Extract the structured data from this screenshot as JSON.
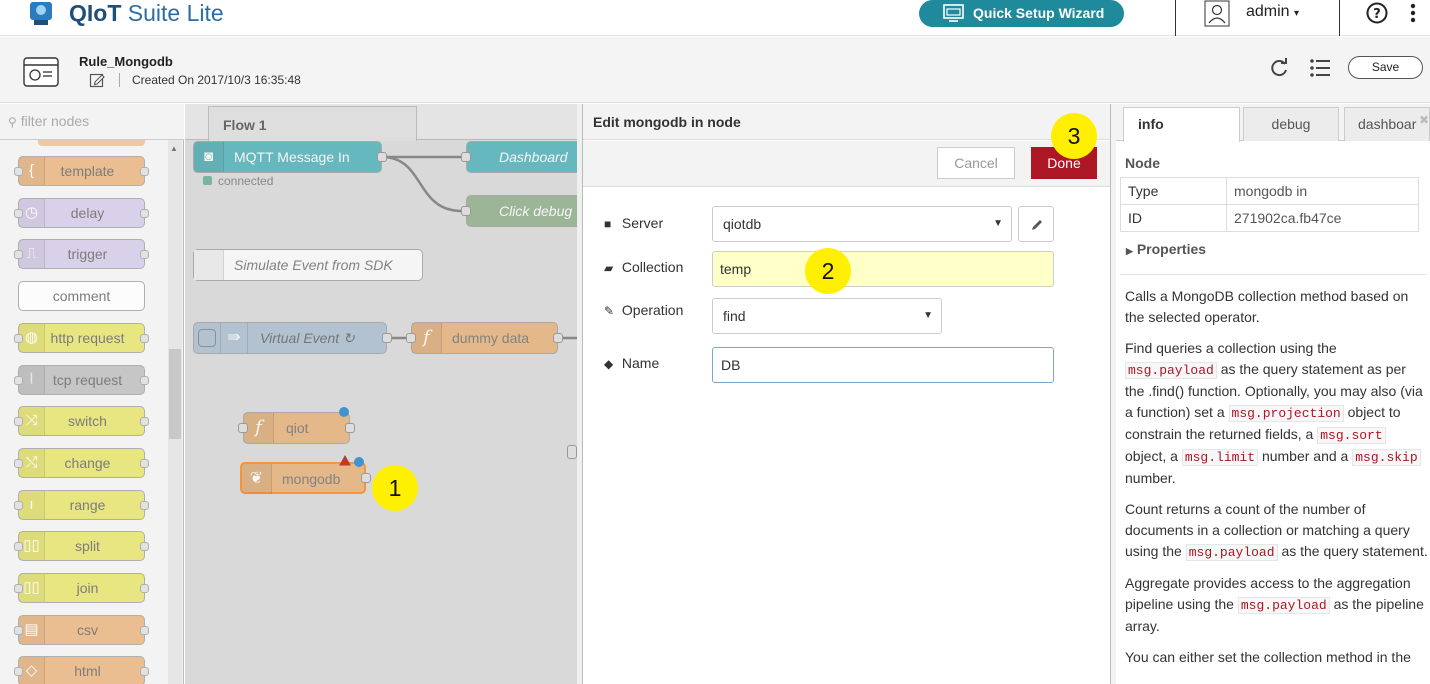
{
  "app": {
    "brand_bold": "QIoT",
    "brand_rest": "Suite Lite",
    "wizard_label": "Quick Setup Wizard",
    "user": "admin"
  },
  "rule": {
    "name": "Rule_Mongodb",
    "created": "Created On 2017/10/3 16:35:48",
    "save_label": "Save"
  },
  "palette": {
    "filter_placeholder": "filter nodes",
    "items": [
      {
        "label": "template",
        "color": "#e8ad6f"
      },
      {
        "label": "delay",
        "color": "#d0c6e6"
      },
      {
        "label": "trigger",
        "color": "#d0c6e6"
      },
      {
        "label": "comment",
        "color": "#ffffff"
      },
      {
        "label": "http request",
        "color": "#e5e25a"
      },
      {
        "label": "tcp request",
        "color": "#b8b8b8"
      },
      {
        "label": "switch",
        "color": "#e5e25a"
      },
      {
        "label": "change",
        "color": "#e5e25a"
      },
      {
        "label": "range",
        "color": "#e5e25a"
      },
      {
        "label": "split",
        "color": "#e5e25a"
      },
      {
        "label": "join",
        "color": "#e5e25a"
      },
      {
        "label": "csv",
        "color": "#e8ad6f"
      },
      {
        "label": "html",
        "color": "#e8ad6f"
      }
    ]
  },
  "flow": {
    "tab_label": "Flow 1",
    "nodes": {
      "mqtt": "MQTT Message In",
      "mqtt_status": "connected",
      "dashboard": "Dashboard",
      "click_debug": "Click debug",
      "simulate": "Simulate Event from SDK",
      "virtual": "Virtual Event ↻",
      "dummy": "dummy data",
      "qiot": "qiot",
      "mongodb": "mongodb"
    }
  },
  "editor": {
    "title": "Edit mongodb in node",
    "cancel_label": "Cancel",
    "done_label": "Done",
    "fields": {
      "server_label": "Server",
      "server_value": "qiotdb",
      "collection_label": "Collection",
      "collection_value": "temp",
      "operation_label": "Operation",
      "operation_value": "find",
      "name_label": "Name",
      "name_value": "DB"
    }
  },
  "badges": {
    "one": "1",
    "two": "2",
    "three": "3"
  },
  "sidebar": {
    "tabs": [
      "info",
      "debug",
      "dashboar"
    ],
    "node_heading": "Node",
    "type_label": "Type",
    "type_value": "mongodb in",
    "id_label": "ID",
    "id_value": "271902ca.fb47ce",
    "properties_label": "Properties",
    "help": {
      "p1": "Calls a MongoDB collection method based on the selected operator.",
      "p2a": "Find queries a collection using the",
      "p2b": "as the query statement as per the .find() function. Optionally, you may also (via a function) set a",
      "p2c": "object to constrain the returned fields, a",
      "p2d": "object, a",
      "p2e": "number and a",
      "p2f": "number.",
      "p3a": "Count returns a count of the number of documents in a collection or matching a query using the",
      "p3b": "as the query statement.",
      "p4a": "Aggregate provides access to the aggregation pipeline using the",
      "p4b": "as the pipeline array.",
      "p5": "You can either set the collection method in the",
      "code_payload": "msg.payload",
      "code_projection": "msg.projection",
      "code_sort": "msg.sort",
      "code_limit": "msg.limit",
      "code_skip": "msg.skip"
    }
  }
}
